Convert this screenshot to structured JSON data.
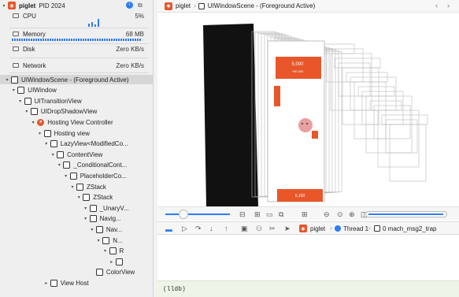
{
  "process": {
    "name": "piglet",
    "pid": "PID 2024"
  },
  "metrics": [
    {
      "label": "CPU",
      "value": "5%"
    },
    {
      "label": "Memory",
      "value": "68 MB"
    },
    {
      "label": "Disk",
      "value": "Zero KB/s"
    },
    {
      "label": "Network",
      "value": "Zero KB/s"
    }
  ],
  "tree": [
    {
      "label": "UIWindowScene - (Foreground Active)",
      "depth": 0,
      "expanded": true,
      "selected": true
    },
    {
      "label": "UIWindow",
      "depth": 1,
      "expanded": true
    },
    {
      "label": "UITransitionView",
      "depth": 2,
      "expanded": true
    },
    {
      "label": "UIDropShadowView",
      "depth": 3,
      "expanded": true
    },
    {
      "label": "Hosting View Controller",
      "depth": 4,
      "expanded": true,
      "icon": "view-controller"
    },
    {
      "label": "Hosting view",
      "depth": 5,
      "expanded": true
    },
    {
      "label": "LazyView<ModifiedCo...",
      "depth": 6,
      "expanded": true
    },
    {
      "label": "ContentView",
      "depth": 7,
      "expanded": true
    },
    {
      "label": "_ConditionalCont...",
      "depth": 8,
      "expanded": true
    },
    {
      "label": "PlaceholderCo...",
      "depth": 9,
      "expanded": true
    },
    {
      "label": "ZStack",
      "depth": 10,
      "expanded": true
    },
    {
      "label": "ZStack",
      "depth": 11,
      "expanded": true
    },
    {
      "label": "_UnaryV...",
      "depth": 12,
      "expanded": true
    },
    {
      "label": "Navig...",
      "depth": 12,
      "expanded": true
    },
    {
      "label": "Nav...",
      "depth": 13,
      "expanded": true
    },
    {
      "label": "N...",
      "depth": 14,
      "expanded": true
    },
    {
      "label": "R",
      "depth": 15,
      "expanded": true
    },
    {
      "label": "",
      "depth": 16,
      "expanded": false
    },
    {
      "label": "ColorView",
      "depth": 13,
      "leaf": true
    },
    {
      "label": "View Host",
      "depth": 6,
      "expanded": false
    }
  ],
  "jumpbar": {
    "app": "piglet",
    "scene": "UIWindowScene - (Foreground Active)"
  },
  "debug": {
    "app": "piglet",
    "thread": "Thread 1",
    "frame": "0 mach_msg2_trap"
  },
  "preview": {
    "amount": "5,000",
    "sub": "+50,000",
    "button": "6,100"
  },
  "console": {
    "prompt": "(lldb)"
  },
  "colors": {
    "accent": "#e8562a",
    "selection": "#d6d6d6",
    "blue": "#3b82f6"
  }
}
